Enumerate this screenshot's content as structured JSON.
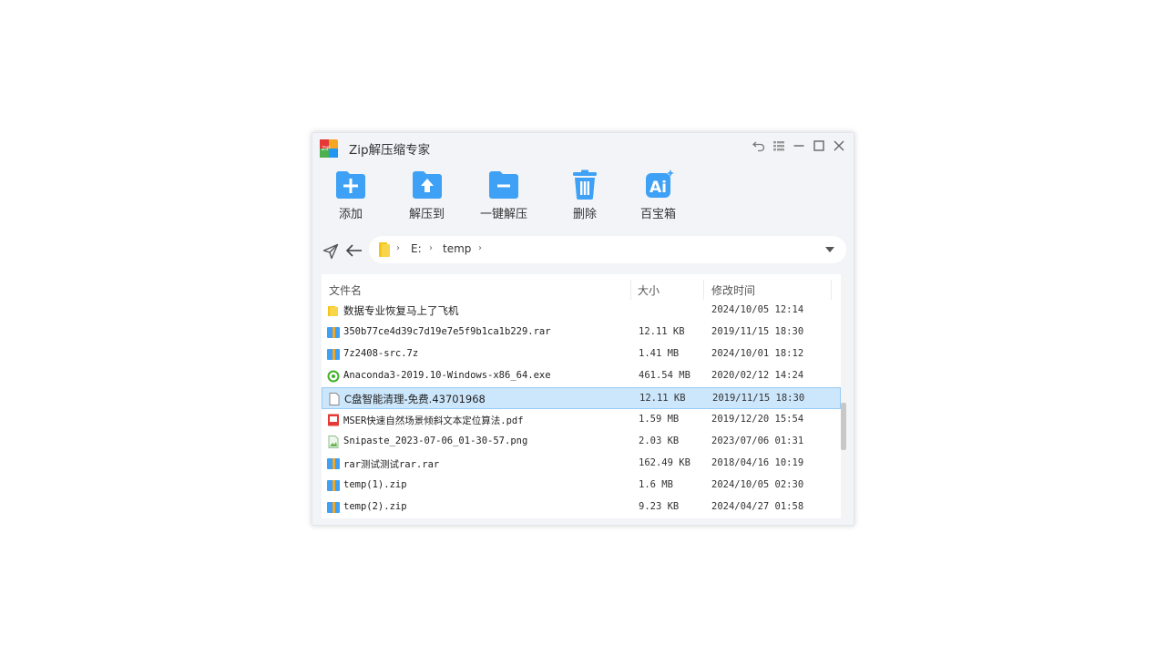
{
  "app": {
    "title": "Zip解压缩专家",
    "accent": "#3ea1f5"
  },
  "toolbar": {
    "items": [
      {
        "label": "添加",
        "icon": "folder-add-icon"
      },
      {
        "label": "解压到",
        "icon": "folder-extract-icon"
      },
      {
        "label": "一键解压",
        "icon": "folder-minus-icon"
      },
      {
        "label": "删除",
        "icon": "trash-icon"
      },
      {
        "label": "百宝箱",
        "icon": "ai-toolbox-icon"
      }
    ]
  },
  "address": {
    "crumbs": [
      "E:",
      "temp"
    ]
  },
  "table": {
    "headers": {
      "name": "文件名",
      "size": "大小",
      "time": "修改时间"
    },
    "rows": [
      {
        "name": "数据专业恢复马上了飞机",
        "size": "",
        "time": "2024/10/05 12:14",
        "icon": "folder-icon"
      },
      {
        "name": "350b77ce4d39c7d19e7e5f9b1ca1b229.rar",
        "size": "12.11 KB",
        "time": "2019/11/15 18:30",
        "icon": "archive-icon"
      },
      {
        "name": "7z2408-src.7z",
        "size": "1.41 MB",
        "time": "2024/10/01 18:12",
        "icon": "archive-icon"
      },
      {
        "name": "Anaconda3-2019.10-Windows-x86_64.exe",
        "size": "461.54 MB",
        "time": "2020/02/12 14:24",
        "icon": "anaconda-icon"
      },
      {
        "name": "C盘智能清理-免费.43701968",
        "size": "12.11 KB",
        "time": "2019/11/15 18:30",
        "icon": "file-icon",
        "selected": true
      },
      {
        "name": "MSER快速自然场景倾斜文本定位算法.pdf",
        "size": "1.59 MB",
        "time": "2019/12/20 15:54",
        "icon": "pdf-icon"
      },
      {
        "name": "Snipaste_2023-07-06_01-30-57.png",
        "size": "2.03 KB",
        "time": "2023/07/06 01:31",
        "icon": "image-icon"
      },
      {
        "name": "rar测试测试rar.rar",
        "size": "162.49 KB",
        "time": "2018/04/16 10:19",
        "icon": "archive-icon"
      },
      {
        "name": "temp(1).zip",
        "size": "1.6 MB",
        "time": "2024/10/05 02:30",
        "icon": "archive-icon"
      },
      {
        "name": "temp(2).zip",
        "size": "9.23 KB",
        "time": "2024/04/27 01:58",
        "icon": "archive-icon"
      }
    ]
  }
}
